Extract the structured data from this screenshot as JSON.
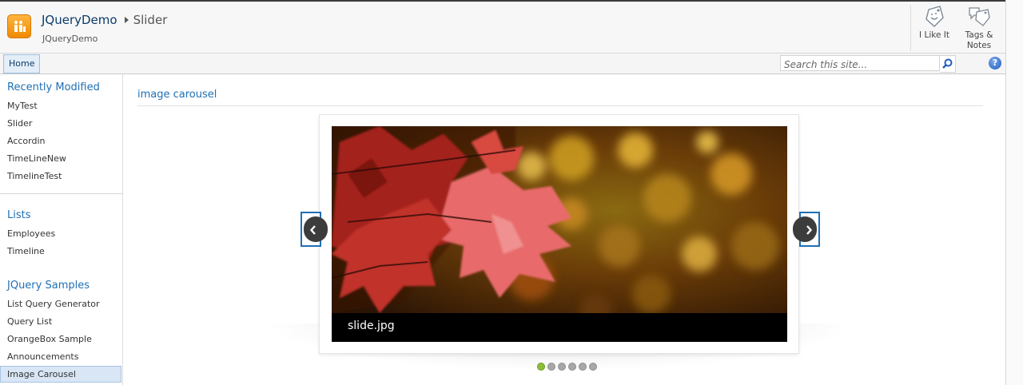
{
  "site": {
    "title": "JQueryDemo",
    "breadcrumb_current": "Slider",
    "subtitle": "JQueryDemo"
  },
  "social": {
    "like_label": "I Like It",
    "tags_label": "Tags & Notes"
  },
  "nav": {
    "home_tab": "Home",
    "search_placeholder": "Search this site...",
    "help_glyph": "?"
  },
  "quick_launch": {
    "recently_modified": {
      "heading": "Recently Modified",
      "items": [
        "MyTest",
        "Slider",
        "Accordin",
        "TimeLineNew",
        "TimelineTest"
      ]
    },
    "lists": {
      "heading": "Lists",
      "items": [
        "Employees",
        "Timeline"
      ]
    },
    "jquery_samples": {
      "heading": "JQuery Samples",
      "items": [
        "List Query Generator",
        "Query List",
        "OrangeBox Sample",
        "Announcements",
        "Image Carousel"
      ],
      "selected": "Image Carousel"
    }
  },
  "content": {
    "webpart_title": "image carousel",
    "carousel": {
      "caption": "slide.jpg",
      "slide_count": 6,
      "active_index": 0
    }
  },
  "icons": {
    "logo": "site-logo-icon",
    "like": "like-tag-icon",
    "tags": "tags-notes-icon",
    "search": "search-icon",
    "help": "help-icon",
    "prev": "chevron-left-icon",
    "next": "chevron-right-icon"
  },
  "colors": {
    "link_blue": "#1f6fb5",
    "title_navy": "#0b3b6a",
    "logo_orange": "#f08a00",
    "active_dot": "#8fbf3a"
  }
}
